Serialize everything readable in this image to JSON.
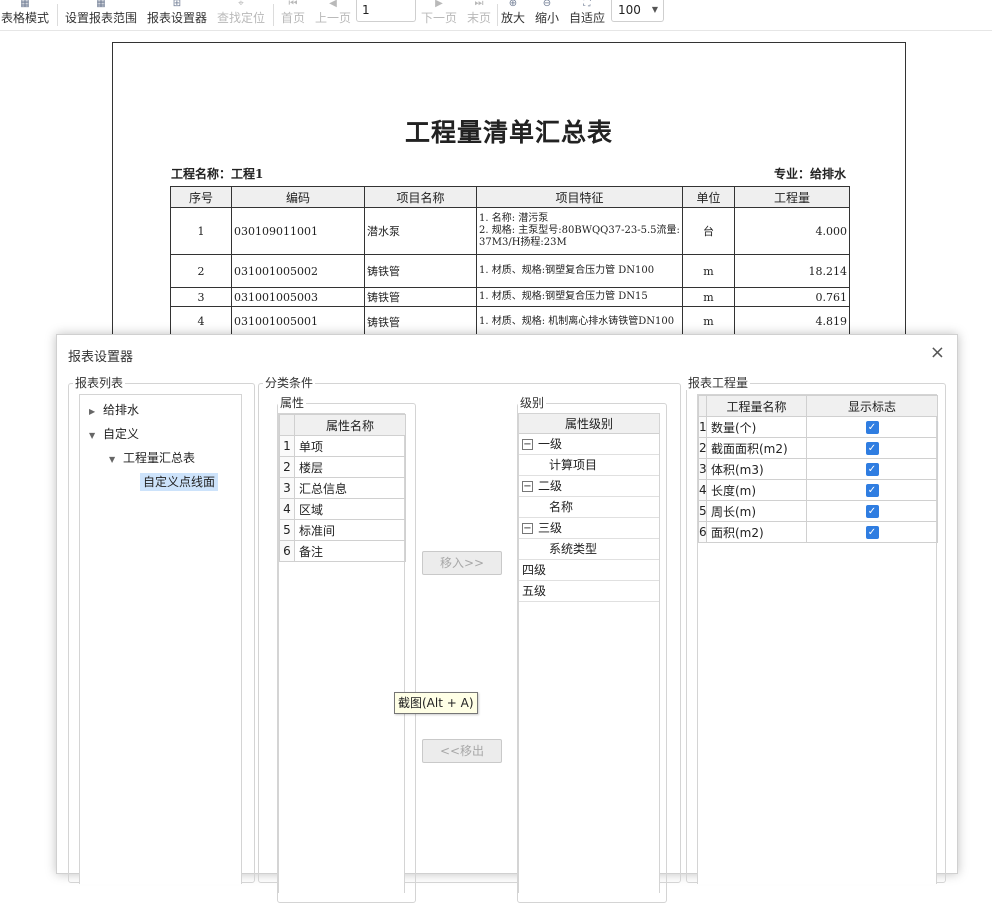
{
  "toolbar": {
    "items": [
      {
        "label": "表格模式",
        "icon": "table-icon",
        "enabled": true
      },
      {
        "label": "设置报表范围",
        "icon": "grid-icon",
        "enabled": true
      },
      {
        "label": "报表设置器",
        "icon": "settings-icon",
        "enabled": true
      },
      {
        "label": "查找定位",
        "icon": "locate-icon",
        "enabled": false
      },
      {
        "label": "首页",
        "icon": "first-page-icon",
        "enabled": false
      },
      {
        "label": "上一页",
        "icon": "prev-page-icon",
        "enabled": false
      },
      {
        "label": "下一页",
        "icon": "next-page-icon",
        "enabled": false
      },
      {
        "label": "末页",
        "icon": "last-page-icon",
        "enabled": false
      },
      {
        "label": "放大",
        "icon": "zoom-in-icon",
        "enabled": true
      },
      {
        "label": "缩小",
        "icon": "zoom-out-icon",
        "enabled": true
      },
      {
        "label": "自适应",
        "icon": "fit-icon",
        "enabled": true
      }
    ],
    "page_value": "1",
    "zoom_value": "100"
  },
  "report": {
    "title": "工程量清单汇总表",
    "project_label": "工程名称：工程1",
    "major_label": "专业：给排水",
    "columns": [
      "序号",
      "编码",
      "项目名称",
      "项目特征",
      "单位",
      "工程量"
    ],
    "rows": [
      {
        "no": "1",
        "code": "030109011001",
        "name": "潜水泵",
        "feature": "1. 名称: 潜污泵\n2. 规格: 主泵型号:80BWQQ37-23-5.5流量:37M3/H扬程:23M",
        "unit": "台",
        "qty": "4.000"
      },
      {
        "no": "2",
        "code": "031001005002",
        "name": "铸铁管",
        "feature": "1. 材质、规格:钢塑复合压力管 DN100",
        "unit": "m",
        "qty": "18.214"
      },
      {
        "no": "3",
        "code": "031001005003",
        "name": "铸铁管",
        "feature": "1. 材质、规格:钢塑复合压力管 DN15",
        "unit": "m",
        "qty": "0.761"
      },
      {
        "no": "4",
        "code": "031001005001",
        "name": "铸铁管",
        "feature": "1. 材质、规格: 机制离心排水铸铁管DN100",
        "unit": "m",
        "qty": "4.819"
      }
    ]
  },
  "dialog": {
    "title": "报表设置器",
    "close_glyph": "×",
    "report_list": {
      "label": "报表列表",
      "nodes": [
        {
          "label": "给排水",
          "expanded": false
        },
        {
          "label": "自定义",
          "expanded": true
        },
        {
          "label": "工程量汇总表",
          "expanded": true
        },
        {
          "label": "自定义点线面",
          "selected": true
        }
      ]
    },
    "classification": {
      "label": "分类条件",
      "attributes": {
        "label": "属性",
        "header": "属性名称",
        "items": [
          "单项",
          "楼层",
          "汇总信息",
          "区域",
          "标准间",
          "备注"
        ]
      },
      "move_in": "移入>>",
      "move_out": "<<移出",
      "levels": {
        "label": "级别",
        "header": "属性级别",
        "items": [
          {
            "label": "一级",
            "group": true
          },
          {
            "label": "计算项目",
            "group": false
          },
          {
            "label": "二级",
            "group": true
          },
          {
            "label": "名称",
            "group": false
          },
          {
            "label": "三级",
            "group": true
          },
          {
            "label": "系统类型",
            "group": false
          },
          {
            "label": "四级",
            "group": false,
            "top": true
          },
          {
            "label": "五级",
            "group": false,
            "top": true
          }
        ]
      }
    },
    "quantities": {
      "label": "报表工程量",
      "headers": [
        "工程量名称",
        "显示标志"
      ],
      "items": [
        {
          "name": "数量(个)",
          "checked": true
        },
        {
          "name": "截面面积(m2)",
          "checked": true
        },
        {
          "name": "体积(m3)",
          "checked": true
        },
        {
          "name": "长度(m)",
          "checked": true
        },
        {
          "name": "周长(m)",
          "checked": true
        },
        {
          "name": "面积(m2)",
          "checked": true
        }
      ]
    },
    "tooltip": "截图(Alt + A)"
  },
  "colors": {
    "checkbox": "#2f7de1",
    "selected": "#cde3fb"
  }
}
